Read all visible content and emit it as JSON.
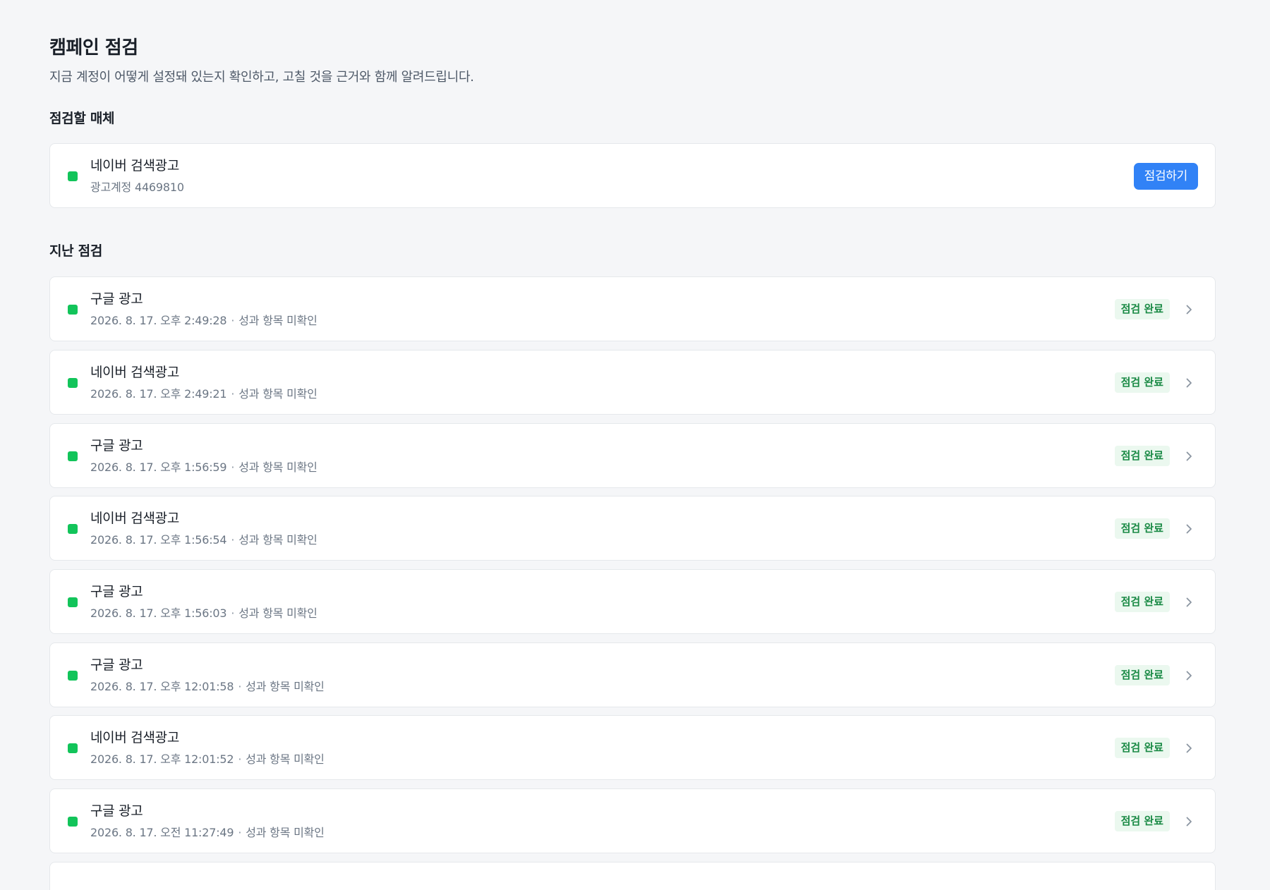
{
  "page": {
    "title": "캠페인 점검",
    "subtitle": "지금 계정이 어떻게 설정돼 있는지 확인하고, 고칠 것을 근거와 함께 알려드립니다."
  },
  "media_section": {
    "heading": "점검할 매체",
    "card": {
      "name": "네이버 검색광고",
      "account": "광고계정 4469810",
      "button_label": "점검하기"
    }
  },
  "history_section": {
    "heading": "지난 점검",
    "items": [
      {
        "name": "구글 광고",
        "timestamp": "2026. 8. 17. 오후 2:49:28",
        "note": "성과 항목 미확인",
        "status": "점검 완료"
      },
      {
        "name": "네이버 검색광고",
        "timestamp": "2026. 8. 17. 오후 2:49:21",
        "note": "성과 항목 미확인",
        "status": "점검 완료"
      },
      {
        "name": "구글 광고",
        "timestamp": "2026. 8. 17. 오후 1:56:59",
        "note": "성과 항목 미확인",
        "status": "점검 완료"
      },
      {
        "name": "네이버 검색광고",
        "timestamp": "2026. 8. 17. 오후 1:56:54",
        "note": "성과 항목 미확인",
        "status": "점검 완료"
      },
      {
        "name": "구글 광고",
        "timestamp": "2026. 8. 17. 오후 1:56:03",
        "note": "성과 항목 미확인",
        "status": "점검 완료"
      },
      {
        "name": "구글 광고",
        "timestamp": "2026. 8. 17. 오후 12:01:58",
        "note": "성과 항목 미확인",
        "status": "점검 완료"
      },
      {
        "name": "네이버 검색광고",
        "timestamp": "2026. 8. 17. 오후 12:01:52",
        "note": "성과 항목 미확인",
        "status": "점검 완료"
      },
      {
        "name": "구글 광고",
        "timestamp": "2026. 8. 17. 오전 11:27:49",
        "note": "성과 항목 미확인",
        "status": "점검 완료"
      }
    ]
  },
  "colors": {
    "background": "#f5f6f8",
    "status_dot": "#12c45a",
    "primary_button": "#3182f6",
    "badge_bg": "#ebf8ef",
    "badge_text": "#1a8a45"
  },
  "icons": {
    "status": "status-dot-icon",
    "row_action": "chevron-right-icon"
  }
}
